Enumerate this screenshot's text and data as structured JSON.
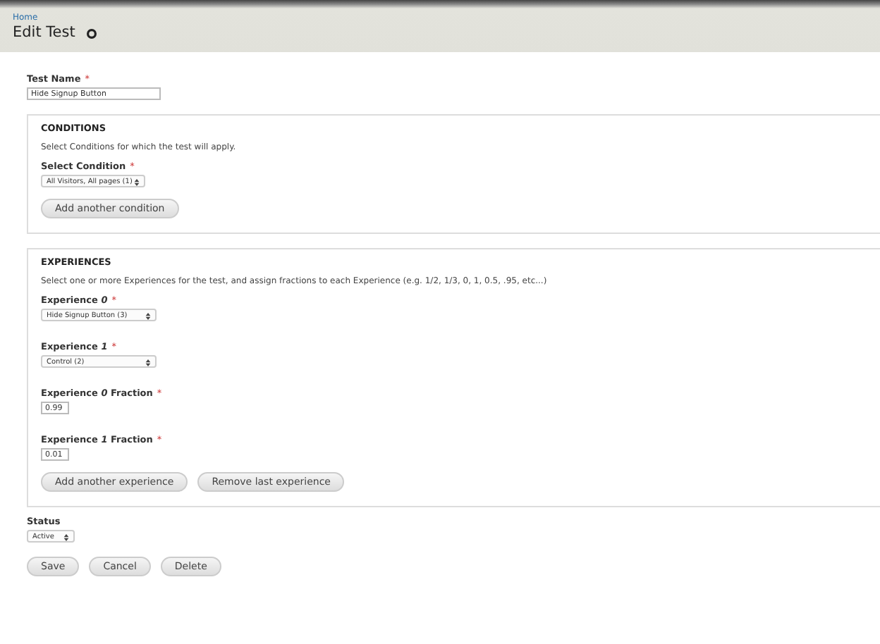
{
  "breadcrumb": "Home",
  "title": "Edit Test",
  "test_name": {
    "label": "Test Name",
    "required_mark": "*",
    "value": "Hide Signup Button"
  },
  "conditions": {
    "legend": "CONDITIONS",
    "description": "Select Conditions for which the test will apply.",
    "selects": [
      {
        "label": "Select Condition",
        "required_mark": "*",
        "value": "All Visitors, All pages (1)"
      }
    ],
    "button": "Add another condition"
  },
  "experiences": {
    "legend": "EXPERIENCES",
    "description": "Select one or more Experiences for the test, and assign fractions to each Experience (e.g. 1/2, 1/3, 0, 1, 0.5, .95, etc...)",
    "fields": [
      {
        "kind": "select",
        "label": "Experience *0*",
        "required_mark": "*",
        "value": "Hide Signup Button (3)"
      },
      {
        "kind": "select",
        "label": "Experience *1*",
        "required_mark": "*",
        "value": "Control (2)"
      },
      {
        "kind": "text",
        "label": "Experience *0* Fraction",
        "required_mark": "*",
        "value": "0.99"
      },
      {
        "kind": "text",
        "label": "Experience *1* Fraction",
        "required_mark": "*",
        "value": "0.01"
      }
    ],
    "buttons": [
      "Add another experience",
      "Remove last experience"
    ]
  },
  "status": {
    "label": "Status",
    "value": "Active"
  },
  "actions": [
    "Save",
    "Cancel",
    "Delete"
  ]
}
